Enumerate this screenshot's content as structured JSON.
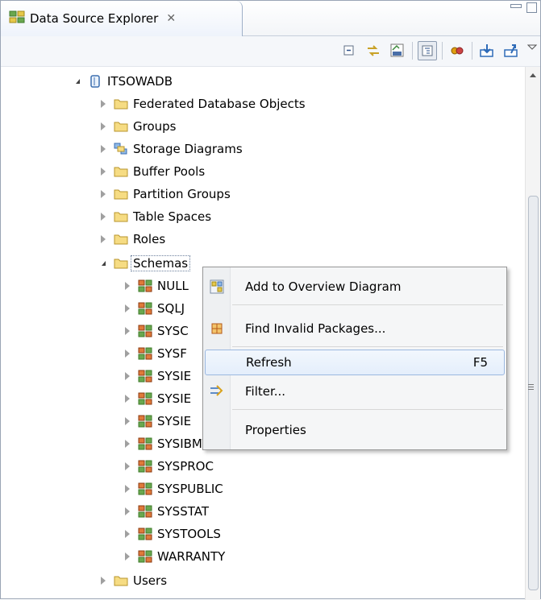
{
  "view": {
    "tab_title": "Data Source Explorer",
    "tab_close_glyph": "✕",
    "tab_icon": "data-source-explorer-icon"
  },
  "toolbar": {
    "icons": [
      "collapse-all-icon",
      "link-with-editor-icon",
      "sql-editor-icon",
      "show-flat-icon",
      "connect-icon",
      "import-icon",
      "export-icon"
    ]
  },
  "tree": {
    "database": "ITSOWADB",
    "folders": [
      {
        "label": "Federated Database Objects",
        "icon": "folder-icon"
      },
      {
        "label": "Groups",
        "icon": "folder-icon"
      },
      {
        "label": "Storage Diagrams",
        "icon": "storage-diagram-icon"
      },
      {
        "label": "Buffer Pools",
        "icon": "folder-icon"
      },
      {
        "label": "Partition Groups",
        "icon": "folder-icon"
      },
      {
        "label": "Table Spaces",
        "icon": "folder-icon"
      },
      {
        "label": "Roles",
        "icon": "folder-icon"
      }
    ],
    "schemas_label": "Schemas",
    "schemas": [
      "NULL",
      "SQLJ",
      "SYSC",
      "SYSF",
      "SYSIE",
      "SYSIE",
      "SYSIE",
      "SYSIBMTS",
      "SYSPROC",
      "SYSPUBLIC",
      "SYSSTAT",
      "SYSTOOLS",
      "WARRANTY"
    ],
    "users_label": "Users"
  },
  "context_menu": {
    "items": [
      {
        "label": "Add to Overview Diagram",
        "icon": "overview-diagram-icon",
        "shortcut": ""
      },
      {
        "label": "Find Invalid Packages...",
        "icon": "packages-icon",
        "shortcut": ""
      },
      {
        "label": "Refresh",
        "icon": "",
        "shortcut": "F5"
      },
      {
        "label": "Filter...",
        "icon": "filter-icon",
        "shortcut": ""
      },
      {
        "label": "Properties",
        "icon": "",
        "shortcut": ""
      }
    ]
  },
  "colors": {
    "folder": "#f2d16b",
    "schema_icon": "#c9622b",
    "menu_hover_border": "#9bb8e0"
  }
}
